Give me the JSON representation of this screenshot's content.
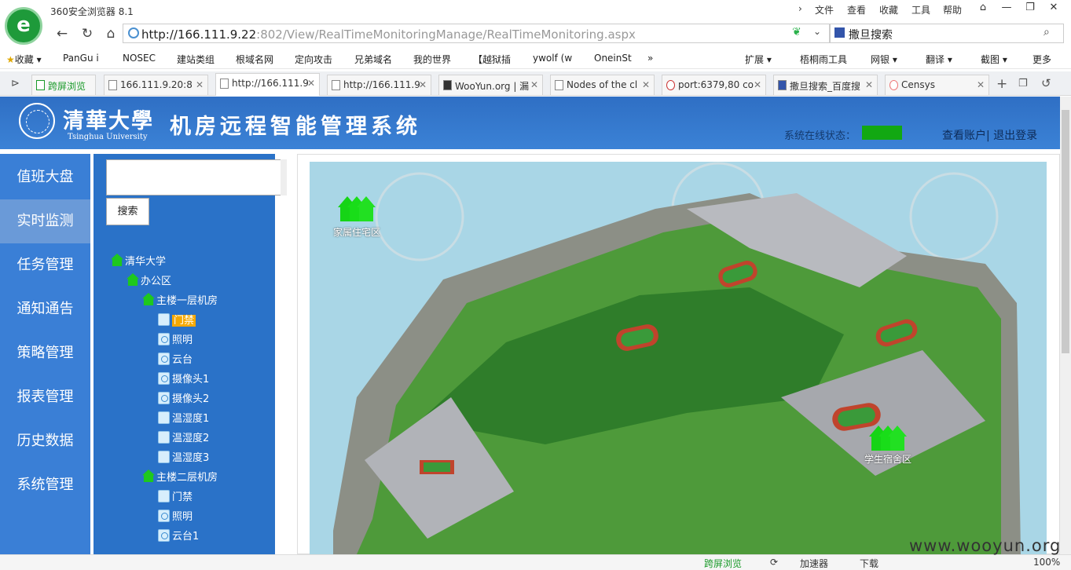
{
  "browser": {
    "title": "360安全浏览器 8.1",
    "menus": [
      "文件",
      "查看",
      "收藏",
      "工具",
      "帮助"
    ],
    "url_host": "http://166.111.9.22",
    "url_path": ":802/View/RealTimeMonitoringManage/RealTimeMonitoring.aspx",
    "search_text": "撒旦搜索",
    "bookmarks": [
      "收藏",
      "PanGu i",
      "NOSEC",
      "建站类组",
      "根域名网",
      "定向攻击",
      "兄弟域名",
      "我的世界",
      "【越狱插",
      "ywolf (w",
      "OneinSt"
    ],
    "bookmark_more": "»",
    "tools": [
      "扩展",
      "梧桐雨工具",
      "网银",
      "翻译",
      "截图",
      "更多"
    ],
    "tabs": [
      "跨屏浏览",
      "166.111.9.20:8",
      "http://166.111.9",
      "http://166.111.9",
      "WooYun.org | 漏",
      "Nodes of the cl",
      "port:6379,80 co",
      "撒旦搜索_百度搜",
      "Censys"
    ],
    "status": [
      "跨屏浏览",
      "加速器",
      "下载",
      "100%"
    ]
  },
  "header": {
    "uni_cn": "清華大學",
    "uni_en": "Tsinghua University",
    "system_title": "机房远程智能管理系统",
    "status_label": "系统在线状态：",
    "account": "查看账户| 退出登录"
  },
  "sidebar": [
    "值班大盘",
    "实时监测",
    "任务管理",
    "通知通告",
    "策略管理",
    "报表管理",
    "历史数据",
    "系统管理"
  ],
  "tree": {
    "search_btn": "搜索",
    "root": "清华大学",
    "office": "办公区",
    "room1": "主楼一层机房",
    "room1_devices": [
      "门禁",
      "照明",
      "云台",
      "摄像头1",
      "摄像头2",
      "温湿度1",
      "温湿度2",
      "温湿度3"
    ],
    "room2": "主楼二层机房",
    "room2_devices": [
      "门禁",
      "照明",
      "云台1"
    ]
  },
  "map": {
    "label_family": "家属住宅区",
    "label_student": "学生宿舍区"
  },
  "watermark": "www.wooyun.org",
  "colors": {
    "header": "#3b82d6",
    "sidebar": "#3a7fd6",
    "status_online": "#12a812",
    "highlight": "#f4a800"
  }
}
